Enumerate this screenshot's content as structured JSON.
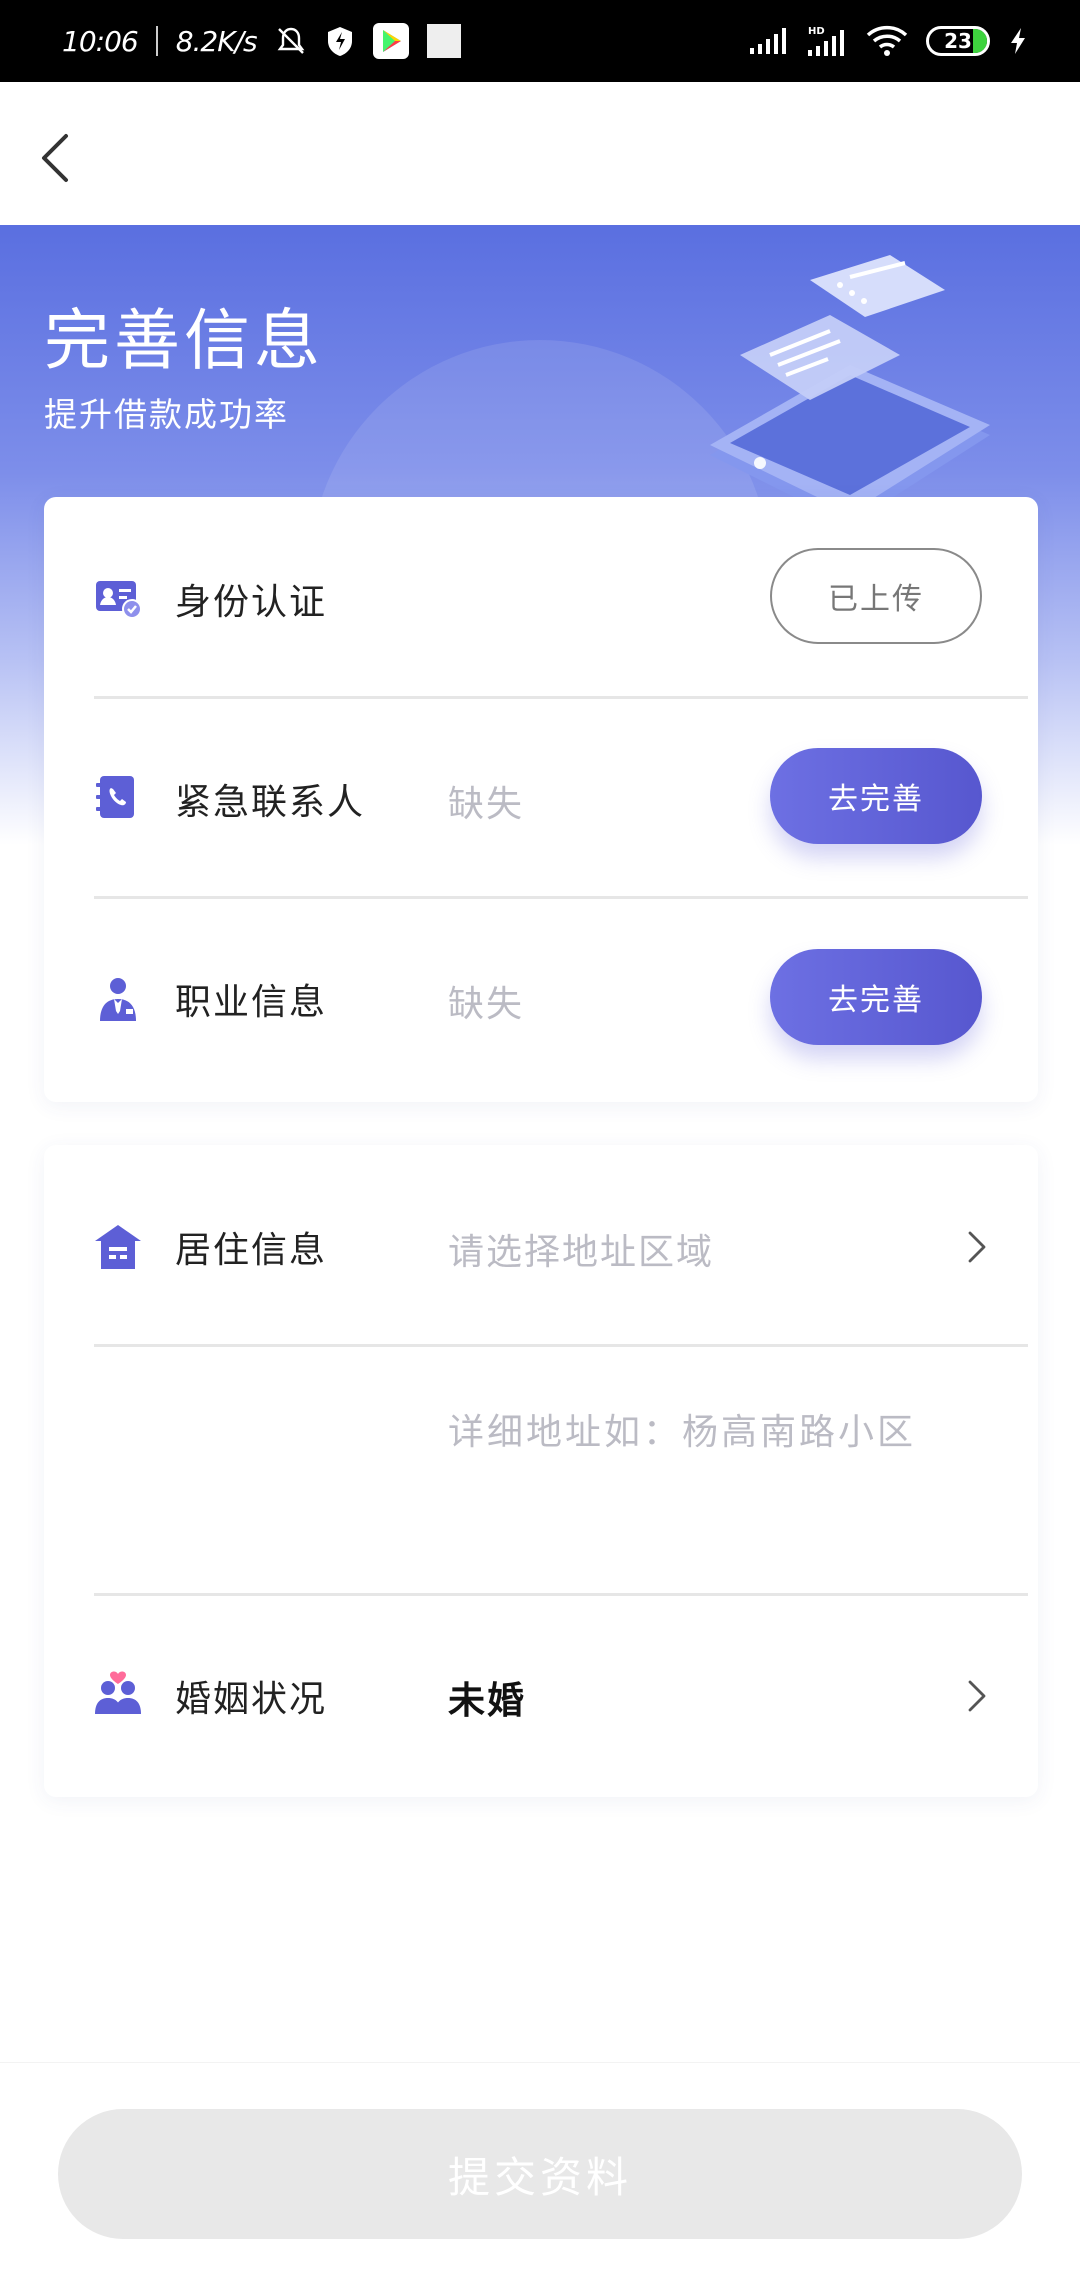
{
  "status_bar": {
    "time": "10:06",
    "speed": "8.2K/s",
    "battery": "23",
    "network_label": "HD"
  },
  "header": {
    "title": "完善信息",
    "subtitle": "提升借款成功率"
  },
  "card1": {
    "rows": [
      {
        "label": "身份认证",
        "status": "",
        "button": "已上传"
      },
      {
        "label": "紧急联系人",
        "status": "缺失",
        "button": "去完善"
      },
      {
        "label": "职业信息",
        "status": "缺失",
        "button": "去完善"
      }
    ]
  },
  "card2": {
    "residence": {
      "label": "居住信息",
      "placeholder": "请选择地址区域"
    },
    "address": {
      "placeholder": "详细地址如：杨高南路小区"
    },
    "marital": {
      "label": "婚姻状况",
      "value": "未婚"
    }
  },
  "footer": {
    "submit_label": "提交资料"
  },
  "colors": {
    "accent": "#5d5fd6",
    "hero": "#5a6fe0",
    "placeholder": "#bbbbc4",
    "disabled_button": "#e8e8e8"
  },
  "icons": {
    "back": "chevron-left-icon",
    "id": "id-card-icon",
    "contact": "phone-book-icon",
    "job": "businessman-icon",
    "home": "house-icon",
    "marriage": "couple-heart-icon",
    "row_arrow": "chevron-right-icon"
  }
}
